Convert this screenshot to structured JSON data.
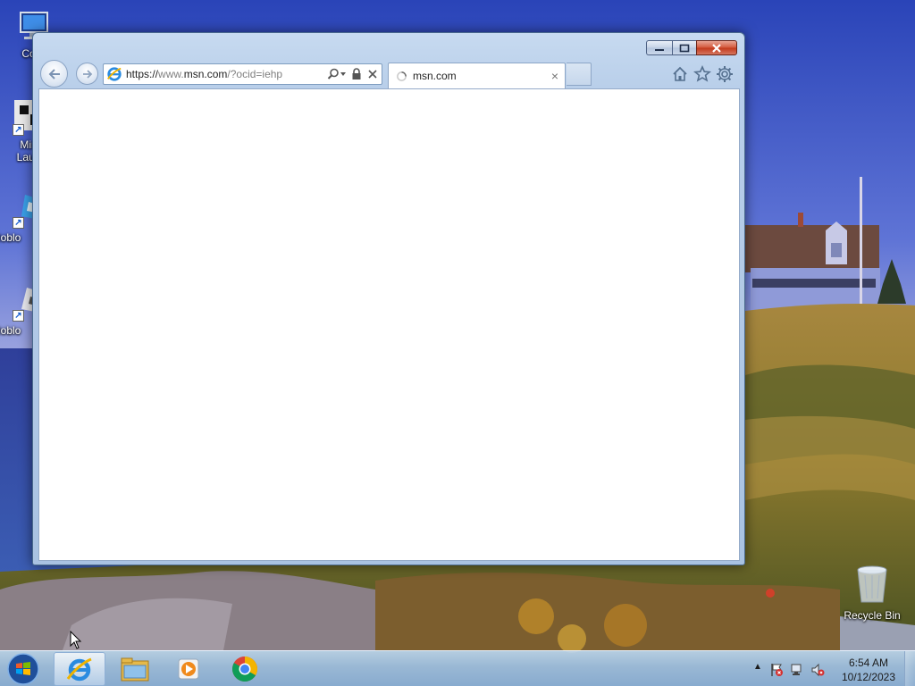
{
  "desktop": {
    "icons": [
      {
        "label": "Com",
        "icon": "computer-icon"
      },
      {
        "label": "Min Laun",
        "icon": "minecraft-launcher-icon"
      },
      {
        "label": "Roblo",
        "icon": "roblox-player-icon"
      },
      {
        "label": "Roblo",
        "icon": "roblox-studio-icon"
      }
    ],
    "recycle_bin_label": "Recycle Bin"
  },
  "browser": {
    "url_prefix": "https://",
    "url_host_dim": "www.",
    "url_host": "msn.com",
    "url_path": "/?ocid=iehp",
    "tab_title": "msn.com",
    "tab_close_glyph": "×",
    "icons": [
      "back-icon",
      "forward-icon",
      "search-icon",
      "lock-icon",
      "stop-icon",
      "home-icon",
      "favorites-icon",
      "tools-icon"
    ]
  },
  "taskbar": {
    "pinned": [
      "internet-explorer-icon",
      "file-explorer-icon",
      "media-player-icon",
      "chrome-icon"
    ],
    "tray_expand_glyph": "▲",
    "clock_time": "6:54 AM",
    "clock_date": "10/12/2023"
  },
  "colors": {
    "accent": "#1a5fd0",
    "close_red": "#c2381a",
    "taskbar": "#a0c0e2"
  }
}
